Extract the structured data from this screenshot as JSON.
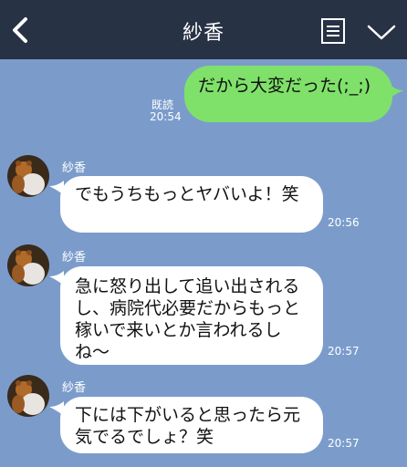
{
  "header": {
    "title": "紗香",
    "back_icon": "chevron-left-icon",
    "note_icon": "note-icon",
    "menu_icon": "chevron-down-icon"
  },
  "outgoing": {
    "text": "だから大変だった(;_;)",
    "read_label": "既読",
    "time": "20:54"
  },
  "incoming": [
    {
      "sender": "紗香",
      "text": "でもうちもっとヤバいよ！笑",
      "time": "20:56"
    },
    {
      "sender": "紗香",
      "text": "急に怒り出して追い出されるし、病院代必要だからもっと稼いで来いとか言われるしね〜",
      "time": "20:57"
    },
    {
      "sender": "紗香",
      "text": "下には下がいると思ったら元気でるでしょ？笑",
      "time": "20:57"
    }
  ],
  "colors": {
    "header_bg": "#273244",
    "chat_bg": "#7b9ccb",
    "outgoing_bubble": "#7fe16a",
    "incoming_bubble": "#ffffff"
  }
}
